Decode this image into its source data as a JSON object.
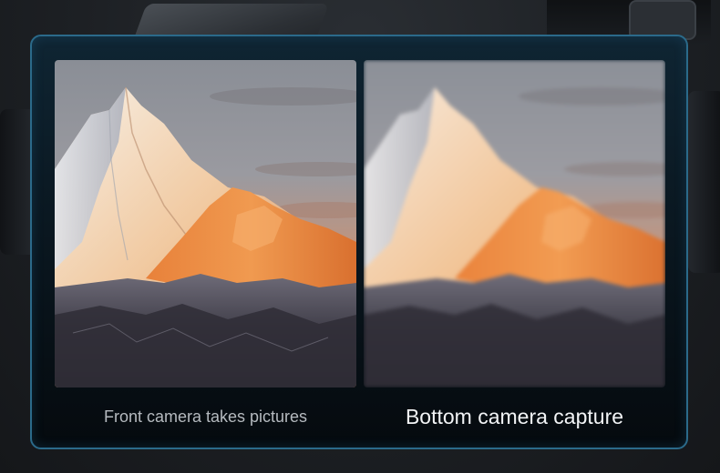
{
  "comparison": {
    "left": {
      "caption": "Front camera takes pictures",
      "image": "mountain-sunset-sharp"
    },
    "right": {
      "caption": "Bottom camera capture",
      "image": "mountain-sunset-blurred"
    }
  },
  "colors": {
    "panel_border": "#2b6a8a",
    "caption_muted": "#b5babf",
    "caption_bright": "#f2f4f6"
  }
}
